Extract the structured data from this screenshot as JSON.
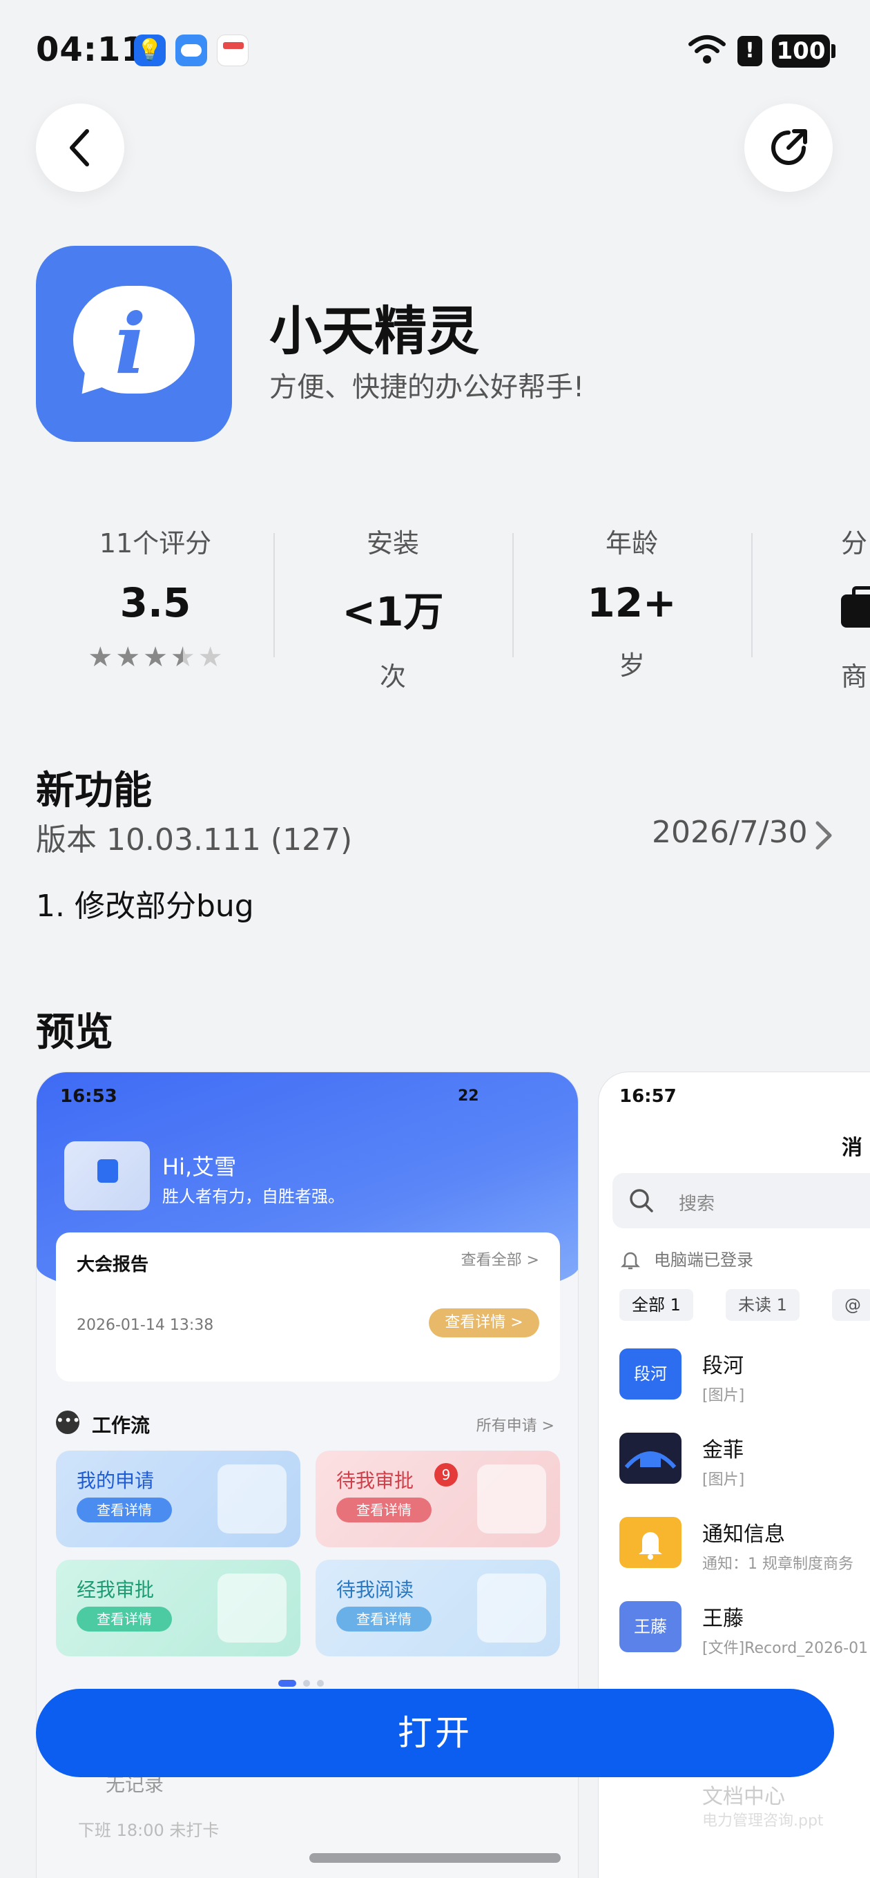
{
  "status_bar": {
    "time": "04:11",
    "battery": "100",
    "alert": "!"
  },
  "app": {
    "name": "小天精灵",
    "subtitle": "方便、快捷的办公好帮手!",
    "icon_glyph": "i"
  },
  "stats": {
    "rating": {
      "label": "11个评分",
      "value": "3.5",
      "stars": 3.5
    },
    "install": {
      "label": "安装",
      "value": "<1万",
      "unit": "次"
    },
    "age": {
      "label": "年龄",
      "value": "12+",
      "unit": "岁"
    },
    "category": {
      "label": "分",
      "unit": "商"
    }
  },
  "new_features": {
    "heading": "新功能",
    "version": "版本 10.03.111 (127)",
    "date": "2026/7/30",
    "changes": "1. 修改部分bug"
  },
  "preview": {
    "heading": "预览",
    "shot1": {
      "time": "16:53",
      "status": "22",
      "greeting": "Hi,艾雪",
      "motto": "胜人者有力，自胜者强。",
      "card": {
        "title": "大会报告",
        "view_all": "查看全部 >",
        "datetime": "2026-01-14 13:38",
        "button": "查看详情 >"
      },
      "workflow": {
        "title": "工作流",
        "all": "所有申请 >"
      },
      "tiles": [
        {
          "title": "我的申请",
          "button": "查看详情"
        },
        {
          "title": "待我审批",
          "button": "查看详情",
          "badge": "9"
        },
        {
          "title": "经我审批",
          "button": "查看详情"
        },
        {
          "title": "待我阅读",
          "button": "查看详情"
        }
      ],
      "no_record": "无记录",
      "bottom_line": "下班 18:00    未打卡"
    },
    "shot2": {
      "time": "16:57",
      "title": "消",
      "search_placeholder": "搜索",
      "login_status": "电脑端已登录",
      "filters": [
        "全部 1",
        "未读 1",
        "@"
      ],
      "messages": [
        {
          "avatar": "段河",
          "name": "段河",
          "preview": "[图片]",
          "color": "#2d6df0"
        },
        {
          "avatar": "",
          "name": "金菲",
          "preview": "[图片]",
          "color": "#1b1f3a"
        },
        {
          "avatar": "",
          "name": "通知信息",
          "preview": "通知：1 规章制度商务",
          "color": "#f7b62d"
        },
        {
          "avatar": "王藤",
          "name": "王藤",
          "preview": "[文件]Record_2026-01",
          "color": "#5b82e8"
        }
      ],
      "doc_center": "文档中心",
      "doc_sub": "电力管理咨询.ppt"
    }
  },
  "open_button": "打开",
  "colors": {
    "accent": "#0b5ef0",
    "app_icon": "#4a7ef0"
  }
}
